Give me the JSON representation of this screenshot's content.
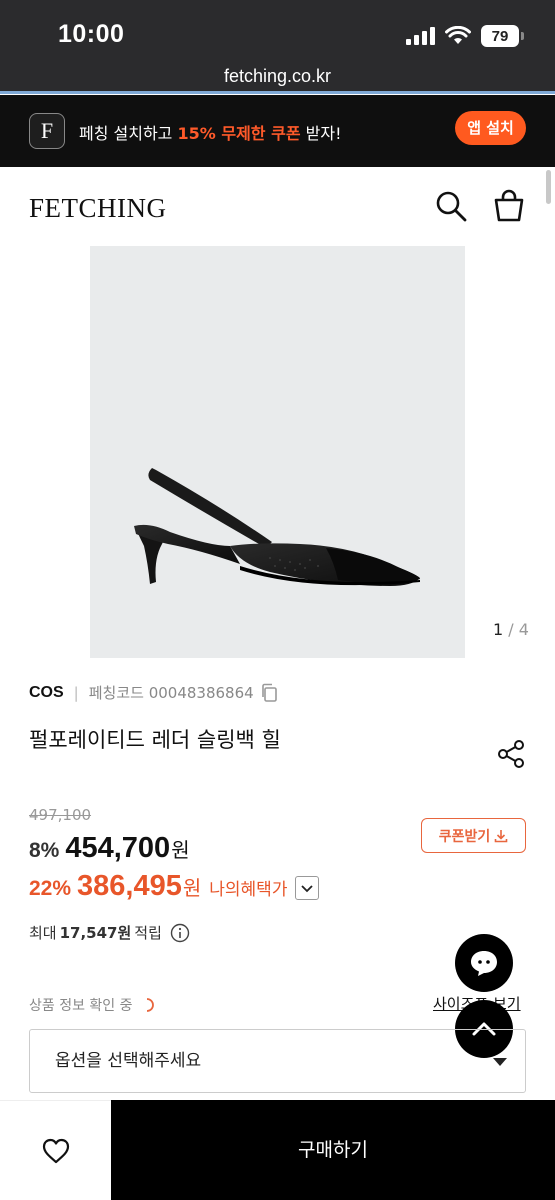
{
  "status_bar": {
    "time": "10:00",
    "battery": "79"
  },
  "browser": {
    "url": "fetching.co.kr"
  },
  "promo": {
    "logo_letter": "F",
    "text_before": "페칭 설치하고 ",
    "highlight": "15% 무제한 쿠폰",
    "text_after": " 받자!",
    "button": "앱 설치"
  },
  "header": {
    "logo": "FETCHING"
  },
  "gallery": {
    "current": "1",
    "separator": " / ",
    "total": "4"
  },
  "product": {
    "brand": "COS",
    "code_label": "페칭코드 00048386864",
    "title": "펄포레이티드 레더 슬링백 힐",
    "original_price": "497,100",
    "discount_pct": "8%",
    "price": "454,700",
    "currency": "원",
    "coupon_button": "쿠폰받기",
    "my_discount_pct": "22%",
    "my_price": "386,495",
    "my_benefit": "나의혜택가",
    "points_prefix": "최대",
    "points_amount": "17,547원",
    "points_suffix": "적립",
    "status_text": "상품 정보 확인 중",
    "size_guide": "사이즈표 보기",
    "option_placeholder": "옵션을 선택해주세요"
  },
  "bottom": {
    "buy_button": "구매하기"
  },
  "colors": {
    "accent": "#e8562a",
    "app_button": "#ff5a1f",
    "dark": "#000000"
  }
}
